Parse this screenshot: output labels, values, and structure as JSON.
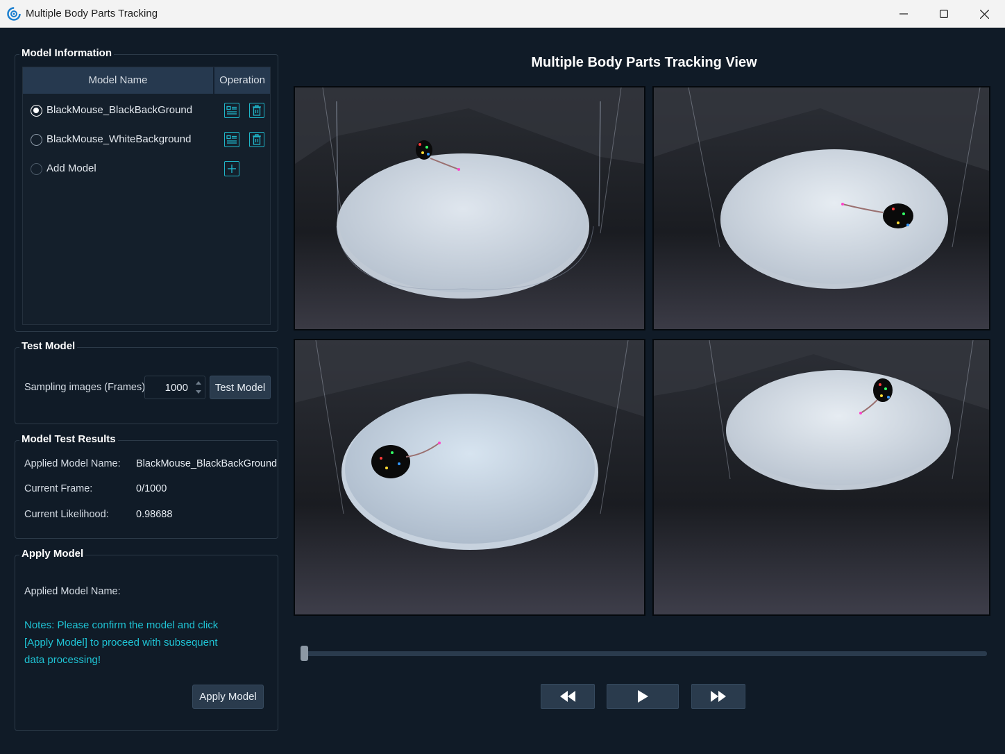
{
  "window": {
    "title": "Multiple Body Parts Tracking",
    "controls": [
      "minimize",
      "maximize",
      "close"
    ]
  },
  "model_info": {
    "title": "Model Information",
    "columns": [
      "Model Name",
      "Operation"
    ],
    "rows": [
      {
        "name": "BlackMouse_BlackBackGround",
        "selected": true,
        "icons": [
          "details-icon",
          "delete-icon"
        ]
      },
      {
        "name": "BlackMouse_WhiteBackground",
        "selected": false,
        "icons": [
          "details-icon",
          "delete-icon"
        ]
      },
      {
        "name": "Add Model",
        "selected": false,
        "icons": [
          "add-icon"
        ]
      }
    ]
  },
  "test_model": {
    "title": "Test Model",
    "sampling_label": "Sampling images (Frames)",
    "sampling_value": "1000",
    "button": "Test Model"
  },
  "results": {
    "title": "Model Test Results",
    "applied_model_label": "Applied Model Name:",
    "applied_model_value": "BlackMouse_BlackBackGround",
    "frame_label": "Current Frame:",
    "frame_value": "0/1000",
    "likelihood_label": "Current Likelihood:",
    "likelihood_value": "0.98688"
  },
  "apply_model": {
    "title": "Apply Model",
    "applied_model_label": "Applied Model Name:",
    "notes_lines": [
      "Notes: Please confirm the model and click",
      "[Apply Model] to proceed with subsequent",
      "data processing!"
    ],
    "button": "Apply Model"
  },
  "view": {
    "title": "Multiple Body Parts Tracking View",
    "cameras": [
      "camera-1",
      "camera-2",
      "camera-3",
      "camera-4"
    ],
    "timeline_position": 0,
    "playback_controls": [
      "rewind-icon",
      "play-icon",
      "fast-forward-icon"
    ]
  },
  "colors": {
    "background": "#101b27",
    "header": "#26394f",
    "button": "#2a3b4d",
    "accent": "#1fc3d4"
  }
}
